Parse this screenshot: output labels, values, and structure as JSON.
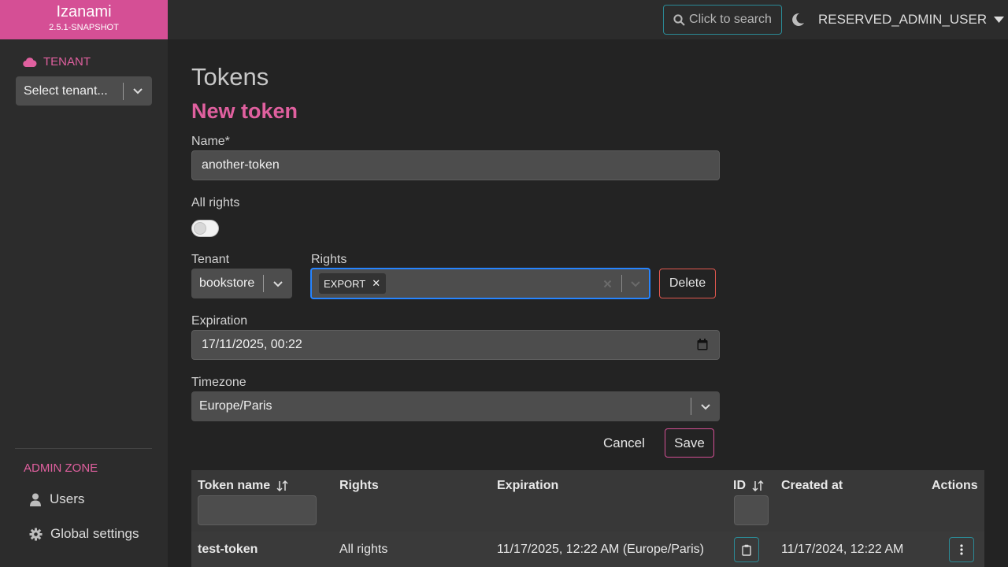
{
  "brand": {
    "name": "Izanami",
    "version": "2.5.1-SNAPSHOT"
  },
  "sidebar": {
    "tenant_label": "TENANT",
    "tenant_select_placeholder": "Select tenant...",
    "admin_zone_label": "ADMIN ZONE",
    "items": [
      {
        "label": "Users",
        "icon": "user-icon"
      },
      {
        "label": "Global settings",
        "icon": "gear-icon"
      }
    ]
  },
  "topbar": {
    "search_label": "Click to search",
    "username": "RESERVED_ADMIN_USER"
  },
  "page": {
    "title": "Tokens",
    "form_title": "New token",
    "name_label": "Name*",
    "name_value": "another-token",
    "all_rights_label": "All rights",
    "all_rights_on": false,
    "tenant_label": "Tenant",
    "tenant_value": "bookstore",
    "rights_label": "Rights",
    "rights_values": [
      "EXPORT"
    ],
    "delete_label": "Delete",
    "expiration_label": "Expiration",
    "expiration_value": "17/11/2025, 00:22",
    "timezone_label": "Timezone",
    "timezone_value": "Europe/Paris",
    "cancel_label": "Cancel",
    "save_label": "Save"
  },
  "table": {
    "columns": [
      "Token name",
      "Rights",
      "Expiration",
      "ID",
      "Created at",
      "Actions"
    ],
    "rows": [
      {
        "name": "test-token",
        "rights": "All rights",
        "expiration": "11/17/2025, 12:22 AM (Europe/Paris)",
        "created_at": "11/17/2024, 12:22 AM"
      }
    ]
  },
  "colors": {
    "brand": "#d54f95",
    "accent_pink": "#e0609f",
    "accent_teal": "#2b8a96",
    "focus_blue": "#2684ff",
    "danger": "#e2584f"
  }
}
